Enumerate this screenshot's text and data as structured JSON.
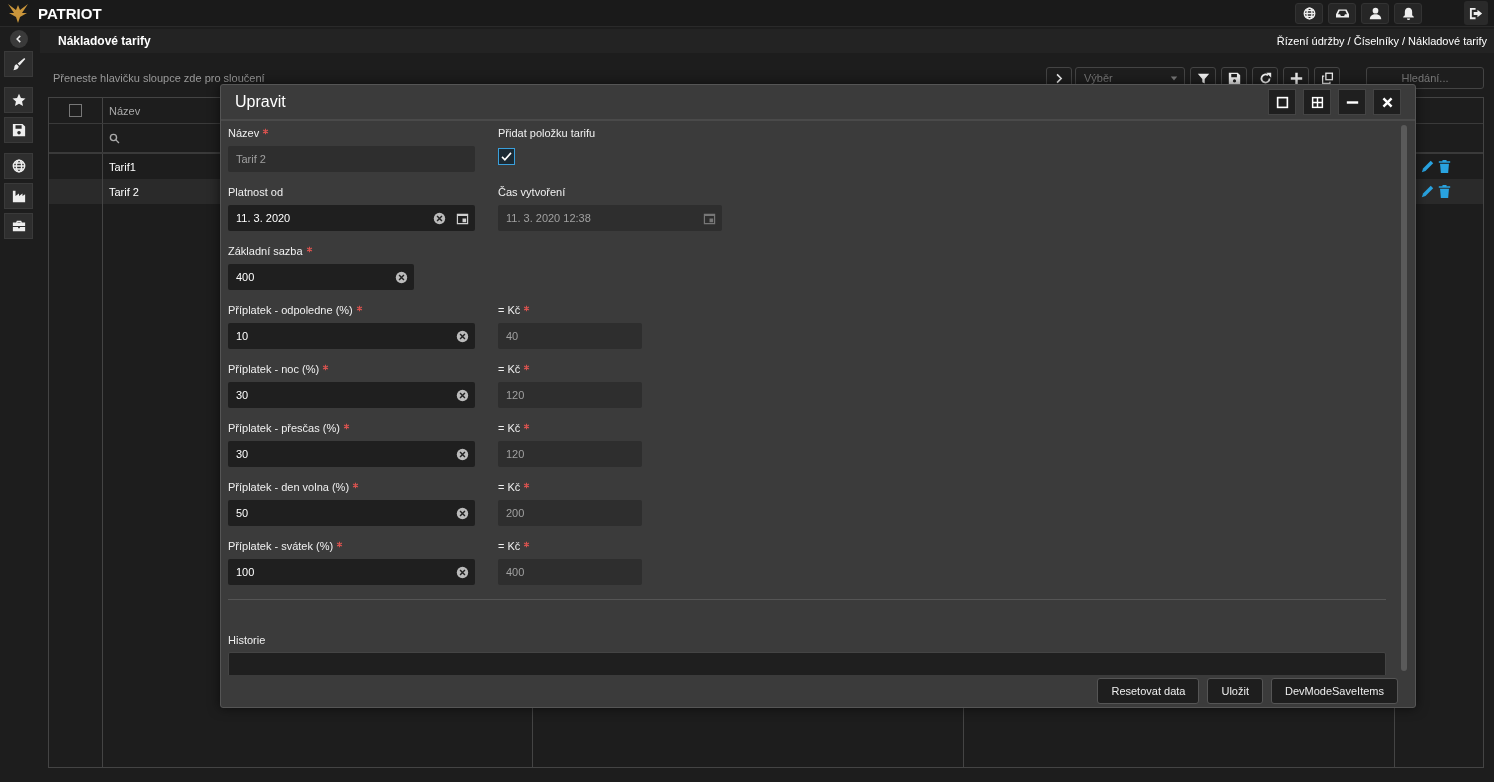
{
  "app": {
    "title": "PATRIOT"
  },
  "page": {
    "title": "Nákladové tarify",
    "breadcrumb": "Řízení údržby / Číselníky / Nákladové tarify"
  },
  "grid": {
    "group_hint": "Přeneste hlavičku sloupce zde pro sloučení",
    "selector": {
      "placeholder": "Výběr"
    },
    "search": {
      "placeholder": "Hledání..."
    },
    "select_all_checked": false,
    "columns": [
      {
        "title": "Název"
      }
    ],
    "rows": [
      {
        "name": "Tarif1"
      },
      {
        "name": "Tarif 2"
      }
    ]
  },
  "dialog": {
    "title": "Upravit",
    "rows": [
      {
        "left": {
          "kind": "text",
          "label": "Název",
          "required": true,
          "value": "Tarif 2",
          "disabled": true
        },
        "right": {
          "kind": "checkbox",
          "label": "Přidat položku tarifu",
          "required": false,
          "checked": true
        }
      },
      {
        "left": {
          "kind": "date",
          "label": "Platnost od",
          "required": false,
          "value": "11. 3. 2020",
          "disabled": false
        },
        "right": {
          "kind": "datetime",
          "label": "Čas vytvoření",
          "required": false,
          "value": "11. 3. 2020 12:38",
          "disabled": true
        }
      },
      {
        "left": {
          "kind": "number",
          "label": "Základní sazba",
          "required": true,
          "value": "400",
          "disabled": false
        }
      },
      {
        "left": {
          "kind": "percent",
          "label": "Příplatek - odpoledne (%)",
          "required": true,
          "value": "10",
          "disabled": false
        },
        "right": {
          "kind": "amount",
          "label": "= Kč",
          "required": true,
          "value": "40",
          "disabled": true
        }
      },
      {
        "left": {
          "kind": "percent",
          "label": "Příplatek - noc (%)",
          "required": true,
          "value": "30",
          "disabled": false
        },
        "right": {
          "kind": "amount",
          "label": "= Kč",
          "required": true,
          "value": "120",
          "disabled": true
        }
      },
      {
        "left": {
          "kind": "percent",
          "label": "Příplatek - přesčas (%)",
          "required": true,
          "value": "30",
          "disabled": false
        },
        "right": {
          "kind": "amount",
          "label": "= Kč",
          "required": true,
          "value": "120",
          "disabled": true
        }
      },
      {
        "left": {
          "kind": "percent",
          "label": "Příplatek - den volna (%)",
          "required": true,
          "value": "50",
          "disabled": false
        },
        "right": {
          "kind": "amount",
          "label": "= Kč",
          "required": true,
          "value": "200",
          "disabled": true
        }
      },
      {
        "left": {
          "kind": "percent",
          "label": "Příplatek - svátek (%)",
          "required": true,
          "value": "100",
          "disabled": false
        },
        "right": {
          "kind": "amount",
          "label": "= Kč",
          "required": true,
          "value": "400",
          "disabled": true
        }
      }
    ],
    "history": {
      "label": "Historie"
    },
    "buttons": [
      {
        "label": "Resetovat data"
      },
      {
        "label": "Uložit"
      },
      {
        "label": "DevModeSaveItems"
      }
    ]
  }
}
